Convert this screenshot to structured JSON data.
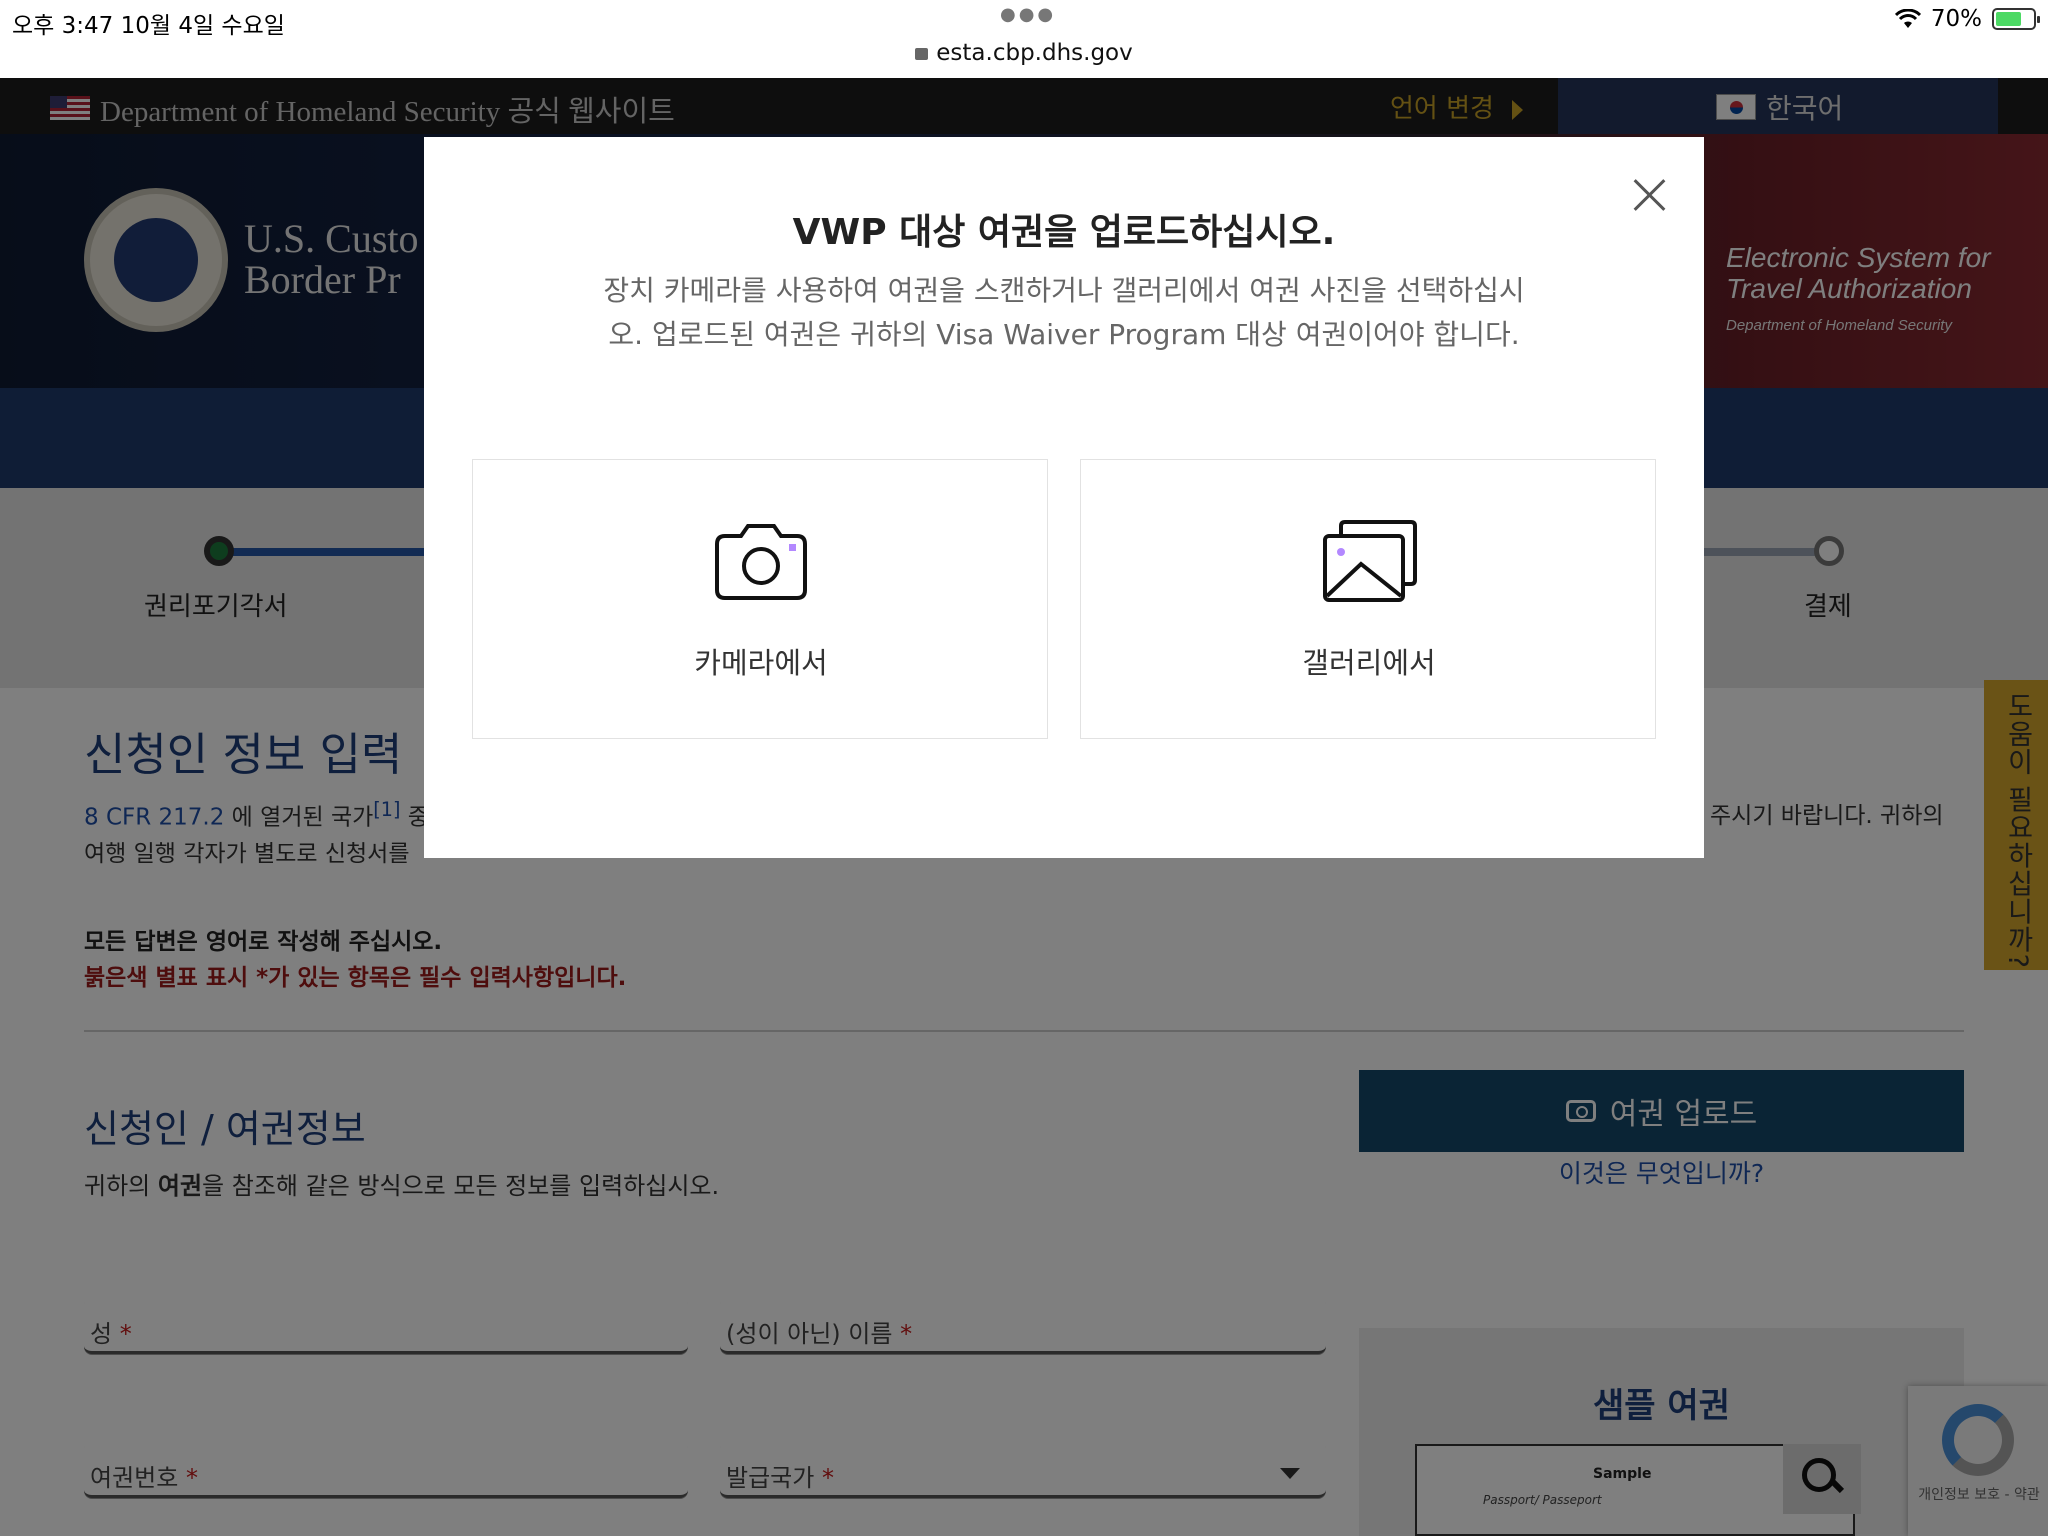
{
  "status_bar": {
    "time_date": "오후 3:47   10월 4일 수요일",
    "url": "esta.cbp.dhs.gov",
    "battery": "70%"
  },
  "header": {
    "dhs_text": "Department of Homeland Security 공식 웹사이트",
    "language_change": "언어 변경",
    "current_language": "한국어",
    "agency_line1": "U.S. Custo",
    "agency_line2": "Border Pr",
    "esta_line1": "Electronic System for",
    "esta_line2": "Travel Authorization",
    "esta_line3": "Department of Homeland Security"
  },
  "progress": {
    "first_step": "권리포기각서",
    "last_step": "결제"
  },
  "help_tab": "도움이 필요하십니까?",
  "page": {
    "title": "신청인 정보 입력",
    "para_link": "8 CFR 217.2",
    "para_line1_text": " 에 열거된 국가",
    "para_sup": "[1]",
    "para_line1_tail": " 중",
    "para_line1_right": "주시기 바랍니다. 귀하의",
    "para_line2": "여행 일행 각자가 별도로 신청서를",
    "note_english": "모든 답변은 영어로 작성해 주십시오.",
    "note_required": "붉은색 별표 표시 *가 있는 항목은 필수 입력사항입니다.",
    "section_title": "신청인 / 여권정보",
    "section_desc_pre": "귀하의 ",
    "section_desc_bold": "여권",
    "section_desc_post": "을 참조해 같은 방식으로 모든 정보를 입력하십시오.",
    "upload_button": "여권 업로드",
    "what_is_this": "이것은 무엇입니까?",
    "fields": {
      "surname": "성",
      "given_name": "(성이 아닌) 이름",
      "passport_no": "여권번호",
      "issuing_country": "발급국가",
      "required_mark": "*"
    },
    "sample_title": "샘플 여권",
    "sample_card_label": "Sample",
    "sample_card_doc": "Passport/ Passeport",
    "recaptcha_text": "개인정보 보호 - 약관"
  },
  "modal": {
    "title": "VWP 대상 여권을 업로드하십시오.",
    "description": "장치 카메라를 사용하여 여권을 스캔하거나 갤러리에서 여권 사진을 선택하십시오. 업로드된 여권은 귀하의 Visa Waiver Program 대상 여권이어야 합니다.",
    "camera_option": "카메라에서",
    "gallery_option": "갤러리에서"
  },
  "colors": {
    "accent_navy": "#1e3f7a",
    "upload_button": "#15496a",
    "required_red": "#9c1a1a",
    "help_tab": "#d4a72c",
    "icon_purple": "#b388ff"
  }
}
